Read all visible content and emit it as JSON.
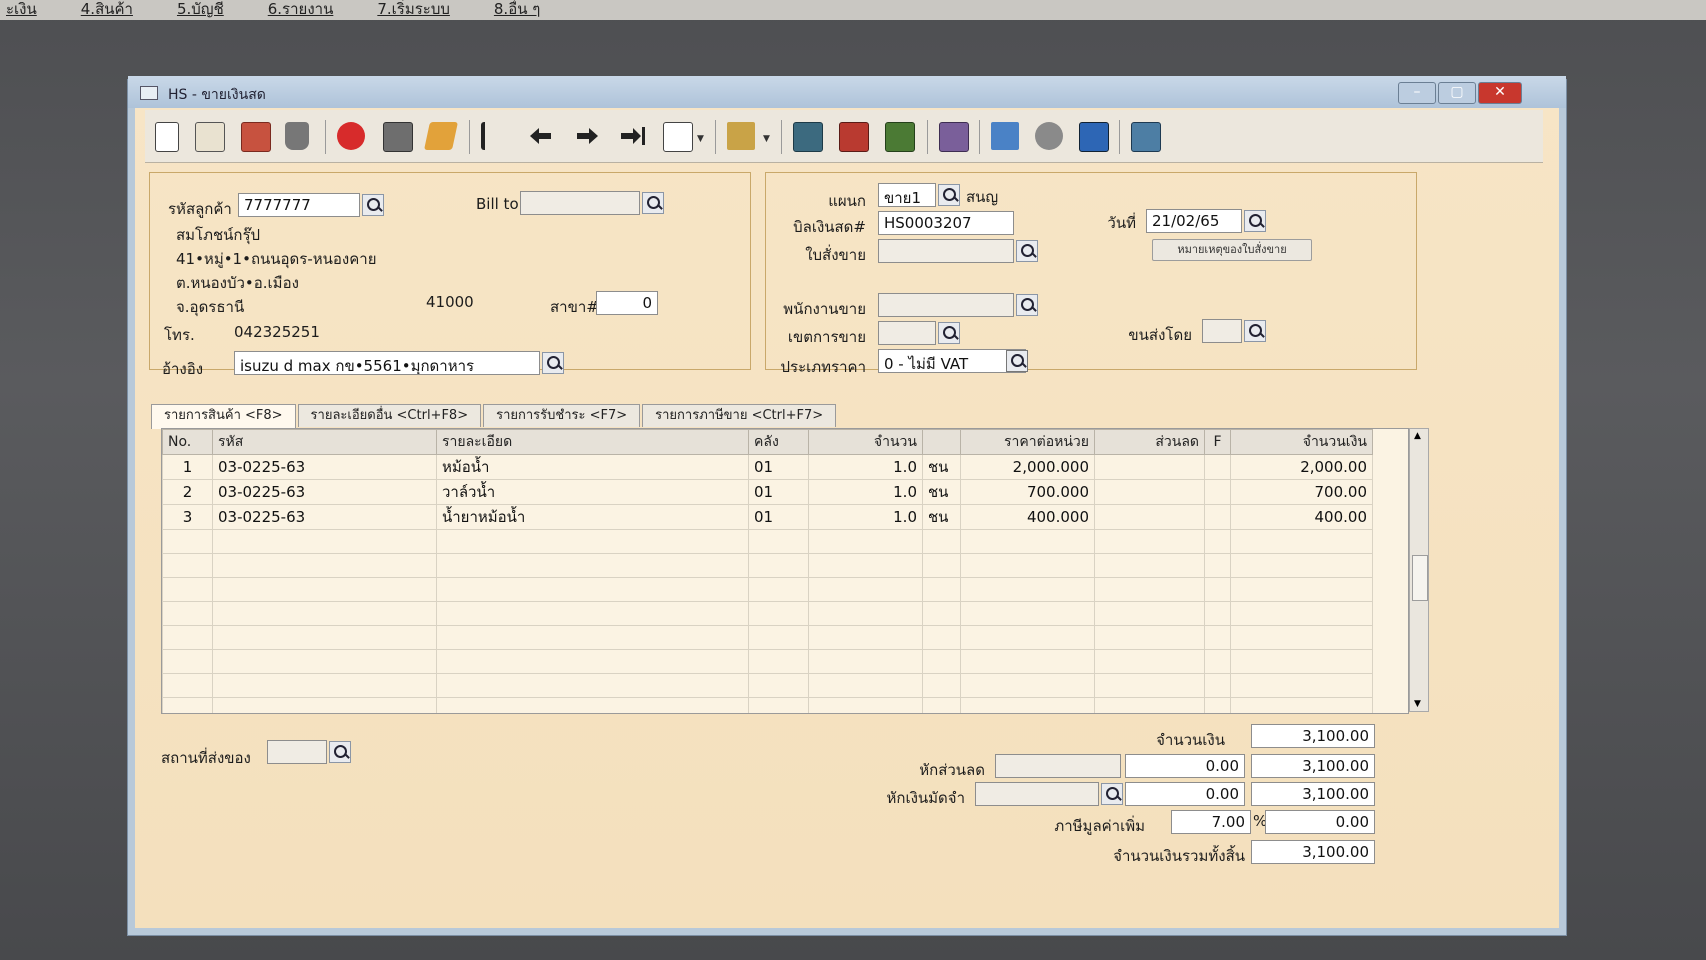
{
  "menu": [
    "ะเงิน",
    "4.สินค้า",
    "5.บัญชี",
    "6.รายงาน",
    "7.เริ่มระบบ",
    "8.อื่น ๆ"
  ],
  "window": {
    "title": "HS - ขายเงินสด"
  },
  "customer": {
    "code_label": "รหัสลูกค้า",
    "code": "7777777",
    "bill_to_label": "Bill to",
    "bill_to": "",
    "name": "สมโภชน์กรุ๊ป",
    "address1": "41•หมู่•1•ถนนอุดร-หนองคาย",
    "address2": "ต.หนองบัว•อ.เมือง",
    "province": "จ.อุดรธานี",
    "postcode": "41000",
    "branch_label": "สาขา#",
    "branch": "0",
    "phone_label": "โทร.",
    "phone": "042325251",
    "ref_label": "อ้างอิง",
    "ref": "isuzu d max กข•5561•มุกดาหาร"
  },
  "doc": {
    "dept_label": "แผนก",
    "dept": "ขาย1",
    "dept_name": "สนญ",
    "bill_label": "บิลเงินสด#",
    "bill": "HS0003207",
    "date_label": "วันที่",
    "date": "21/02/65",
    "order_label": "ใบสั่งขาย",
    "order": "",
    "order_note_button": "หมายเหตุของใบสั่งขาย",
    "salesman_label": "พนักงานขาย",
    "salesman": "",
    "area_label": "เขตการขาย",
    "area": "",
    "ship_by_label": "ขนส่งโดย",
    "ship_by": "",
    "price_type_label": "ประเภทราคา",
    "price_type": "0 - ไม่มี VAT"
  },
  "tabs": [
    "รายการสินค้า <F8>",
    "รายละเอียดอื่น <Ctrl+F8>",
    "รายการรับชำระ <F7>",
    "รายการภาษีขาย <Ctrl+F7>"
  ],
  "table": {
    "headers": [
      "No.",
      "รหัส",
      "รายละเอียด",
      "คลัง",
      "จำนวน",
      "",
      "ราคาต่อหน่วย",
      "ส่วนลด",
      "F",
      "จำนวนเงิน"
    ],
    "rows": [
      [
        "1",
        "03-0225-63",
        "หม้อน้ำ",
        "01",
        "1.0",
        "ชน",
        "2,000.000",
        "",
        "",
        "2,000.00"
      ],
      [
        "2",
        "03-0225-63",
        "วาล์วน้ำ",
        "01",
        "1.0",
        "ชน",
        "700.000",
        "",
        "",
        "700.00"
      ],
      [
        "3",
        "03-0225-63",
        "น้ำยาหม้อน้ำ",
        "01",
        "1.0",
        "ชน",
        "400.000",
        "",
        "",
        "400.00"
      ]
    ]
  },
  "footer": {
    "ship_place_label": "สถานที่ส่งของ",
    "ship_place": "",
    "amount_label": "จำนวนเงิน",
    "amount": "3,100.00",
    "discount_label": "หักส่วนลด",
    "discount_code": "",
    "discount_value": "0.00",
    "after_discount": "3,100.00",
    "deposit_label": "หักเงินมัดจำ",
    "deposit_code": "",
    "deposit_value": "0.00",
    "after_deposit": "3,100.00",
    "vat_label": "ภาษีมูลค่าเพิ่ม",
    "vat_rate": "7.00",
    "vat_unit": "%",
    "vat_amount": "0.00",
    "total_label": "จำนวนเงินรวมทั้งสิ้น",
    "total": "3,100.00"
  },
  "colors": {
    "window_bg": "#f4e0bd",
    "panel_border": "#c9a86a",
    "titlebar": "#aec3d9",
    "close": "#c8372d"
  }
}
